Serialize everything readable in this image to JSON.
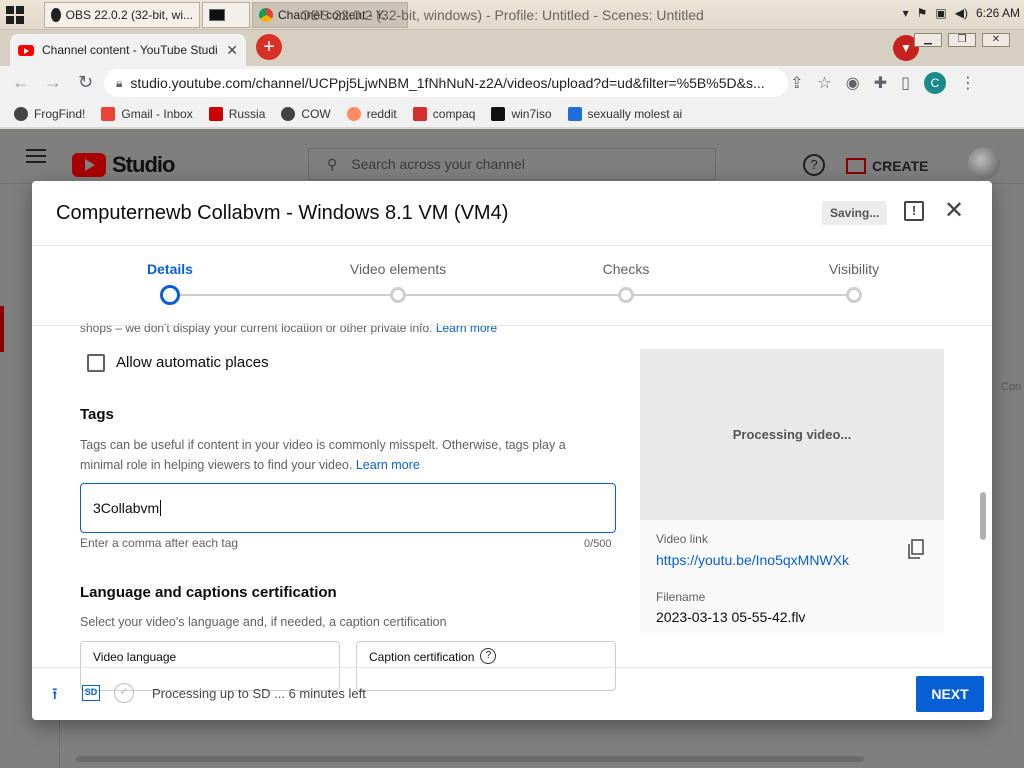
{
  "taskbar": {
    "buttons": [
      "OBS 22.0.2 (32-bit, wi...",
      "",
      "Channel content - Y..."
    ],
    "window_title": "OBS 22.0.2 (32-bit, windows) - Profile: Untitled - Scenes: Untitled",
    "time": "6:26 AM"
  },
  "browser": {
    "tab_title": "Channel content - YouTube Studi",
    "url": "studio.youtube.com/channel/UCPpj5LjwNBM_1fNhNuN-z2A/videos/upload?d=ud&filter=%5B%5D&s...",
    "profile_initial": "C",
    "bookmarks": [
      "FrogFind!",
      "Gmail - Inbox",
      "Russia",
      "COW",
      "reddit",
      "compaq",
      "win7iso",
      "sexually molest ai"
    ]
  },
  "studio": {
    "logo_text": "Studio",
    "search_placeholder": "Search across your channel",
    "create_label": "CREATE",
    "right_cut_text": "Con"
  },
  "dialog": {
    "title": "Computernewb Collabvm - Windows 8.1 VM (VM4)",
    "saving_label": "Saving...",
    "steps": [
      "Details",
      "Video elements",
      "Checks",
      "Visibility"
    ],
    "active_step": "Details",
    "location_note": "shops – we don't display your current location or other private info.",
    "learn_more": "Learn more",
    "allow_places_label": "Allow automatic places",
    "tags": {
      "heading": "Tags",
      "description": "Tags can be useful if content in your video is commonly misspelt. Otherwise, tags play a minimal role in helping viewers to find your video.",
      "learn_more": "Learn more",
      "value": "3Collabvm",
      "hint": "Enter a comma after each tag",
      "count": "0/500"
    },
    "language": {
      "heading": "Language and captions certification",
      "description": "Select your video's language and, if needed, a caption certification",
      "video_language_label": "Video language",
      "caption_cert_label": "Caption certification"
    },
    "preview": {
      "processing_text": "Processing video...",
      "video_link_label": "Video link",
      "video_link": "https://youtu.be/Ino5qxMNWXk",
      "filename_label": "Filename",
      "filename": "2023-03-13 05-55-42.flv"
    },
    "footer": {
      "sd_badge": "SD",
      "status": "Processing up to SD ... 6 minutes left",
      "next_label": "NEXT"
    }
  }
}
